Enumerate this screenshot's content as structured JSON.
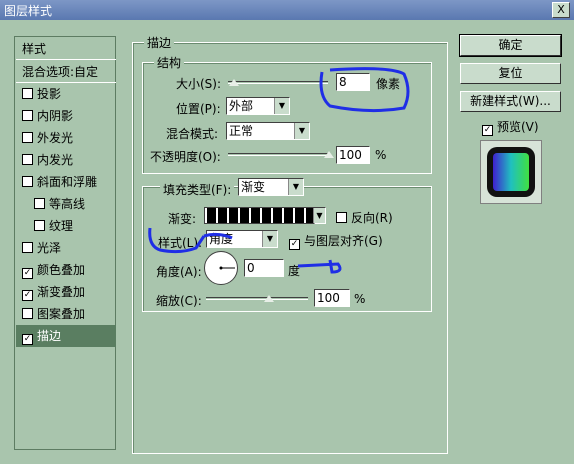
{
  "window": {
    "title": "图层样式",
    "close_label": "X"
  },
  "sidebar": {
    "items": [
      {
        "label": "样式",
        "type": "header"
      },
      {
        "label": "混合选项:自定",
        "type": "header"
      },
      {
        "label": "投影",
        "checked": false
      },
      {
        "label": "内阴影",
        "checked": false
      },
      {
        "label": "外发光",
        "checked": false
      },
      {
        "label": "内发光",
        "checked": false
      },
      {
        "label": "斜面和浮雕",
        "checked": false
      },
      {
        "label": "等高线",
        "checked": false,
        "indent": true
      },
      {
        "label": "纹理",
        "checked": false,
        "indent": true
      },
      {
        "label": "光泽",
        "checked": false
      },
      {
        "label": "颜色叠加",
        "checked": true
      },
      {
        "label": "渐变叠加",
        "checked": true
      },
      {
        "label": "图案叠加",
        "checked": false
      },
      {
        "label": "描边",
        "checked": true,
        "selected": true
      }
    ],
    "check_mark": "✓"
  },
  "stroke": {
    "group_title": "描边",
    "structure_title": "结构",
    "size_label": "大小(S):",
    "size_value": "8",
    "size_unit": "像素",
    "position_label": "位置(P):",
    "position_value": "外部",
    "blend_label": "混合模式:",
    "blend_value": "正常",
    "opacity_label": "不透明度(O):",
    "opacity_value": "100",
    "opacity_unit": "%"
  },
  "fill": {
    "type_label": "填充类型(F):",
    "type_value": "渐变",
    "gradient_label": "渐变:",
    "reverse_label": "反向(R)",
    "reverse_checked": false,
    "style_label": "样式(L):",
    "style_value": "角度",
    "align_label": "与图层对齐(G)",
    "align_checked": true,
    "angle_label": "角度(A):",
    "angle_value": "0",
    "angle_unit": "度",
    "scale_label": "缩放(C):",
    "scale_value": "100",
    "scale_unit": "%"
  },
  "buttons": {
    "ok": "确定",
    "reset": "复位",
    "new_style": "新建样式(W)...",
    "preview_label": "预览(V)",
    "preview_checked": true
  },
  "icons": {
    "dropdown": "▼"
  },
  "colors": {
    "background": "#a9c5ad",
    "selected": "#5a7e61",
    "annotation": "#1f2ee6"
  }
}
